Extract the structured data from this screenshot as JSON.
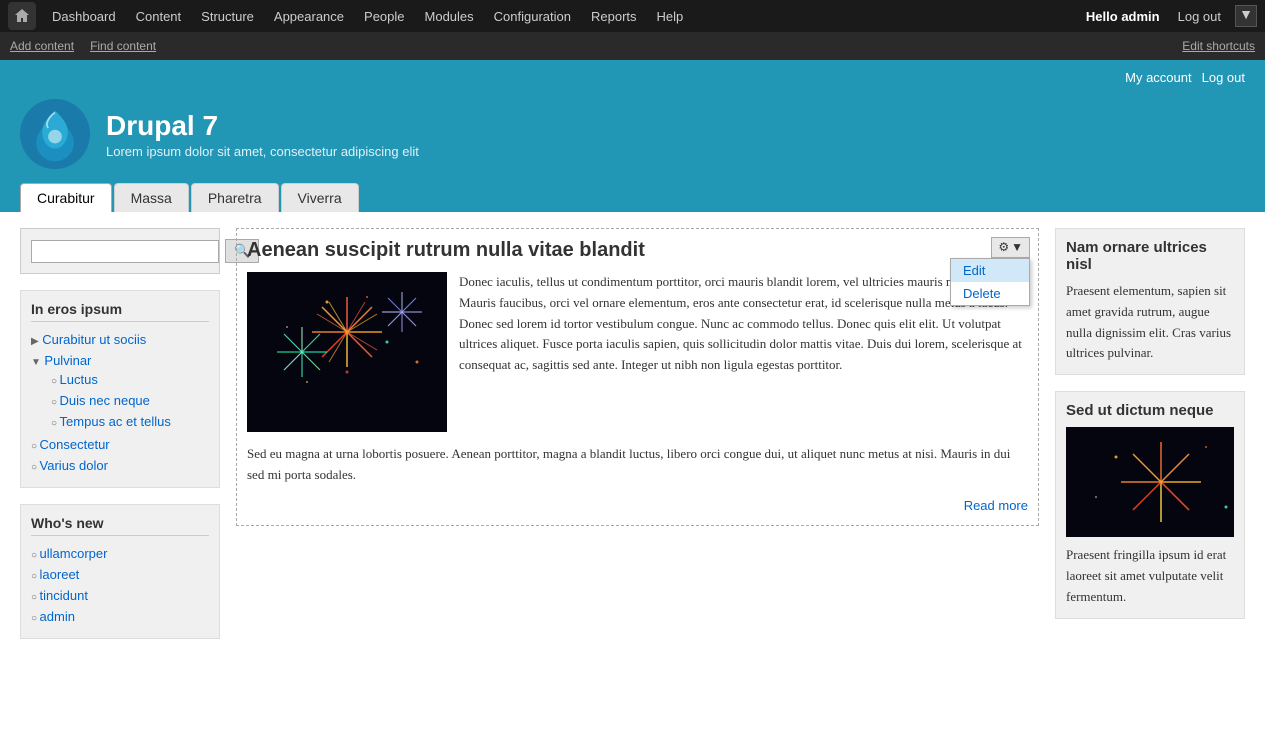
{
  "admin_toolbar": {
    "home_label": "Home",
    "nav_items": [
      "Dashboard",
      "Content",
      "Structure",
      "Appearance",
      "People",
      "Modules",
      "Configuration",
      "Reports",
      "Help"
    ],
    "hello_text": "Hello",
    "username": "admin",
    "logout_label": "Log out"
  },
  "shortcuts_bar": {
    "add_content": "Add content",
    "find_content": "Find content",
    "edit_shortcuts": "Edit shortcuts"
  },
  "site_header": {
    "my_account": "My account",
    "logout": "Log out",
    "site_name": "Drupal 7",
    "slogan": "Lorem ipsum dolor sit amet, consectetur adipiscing elit"
  },
  "nav_tabs": {
    "tabs": [
      "Curabitur",
      "Massa",
      "Pharetra",
      "Viverra"
    ],
    "active": "Curabitur"
  },
  "sidebar": {
    "search_placeholder": "",
    "search_btn": "Search",
    "nav_block_title": "In eros ipsum",
    "nav_items": [
      {
        "label": "Curabitur ut sociis",
        "type": "arrow-right",
        "children": []
      },
      {
        "label": "Pulvinar",
        "type": "arrow-down",
        "children": [
          "Luctus",
          "Duis nec neque",
          "Tempus ac et tellus"
        ]
      },
      {
        "label": "Consectetur",
        "type": "bullet",
        "children": []
      },
      {
        "label": "Varius dolor",
        "type": "bullet",
        "children": []
      }
    ],
    "whats_new_title": "Who's new",
    "whats_new_items": [
      "ullamcorper",
      "laoreet",
      "tincidunt",
      "admin"
    ]
  },
  "article": {
    "title": "Aenean suscipit rutrum nulla vitae blandit",
    "gear_icon": "⚙",
    "dropdown": {
      "edit": "Edit",
      "delete": "Delete"
    },
    "body": "Donec iaculis, tellus ut condimentum porttitor, orci mauris blandit lorem, vel ultricies mauris metus eu dui. Mauris faucibus, orci vel ornare elementum, eros ante consectetur erat, id scelerisque nulla metus a lacus. Donec sed lorem id tortor vestibulum congue. Nunc ac commodo tellus. Donec quis elit elit. Ut volutpat ultrices aliquet. Fusce porta iaculis sapien, quis sollicitudin dolor mattis vitae. Duis dui lorem, scelerisque at consequat ac, sagittis sed ante. Integer ut nibh non ligula egestas porttitor.",
    "extra": "Sed eu magna at urna lobortis posuere. Aenean porttitor, magna a blandit luctus, libero orci congue dui, ut aliquet nunc metus at nisi. Mauris in dui sed mi porta sodales.",
    "read_more": "Read more"
  },
  "right_sidebar": {
    "block1": {
      "title": "Nam ornare ultrices nisl",
      "text": "Praesent elementum, sapien sit amet gravida rutrum, augue nulla dignissim elit. Cras varius ultrices pulvinar."
    },
    "block2": {
      "title": "Sed ut dictum neque",
      "text": "Praesent fringilla ipsum id erat laoreet sit amet vulputate velit fermentum."
    }
  }
}
